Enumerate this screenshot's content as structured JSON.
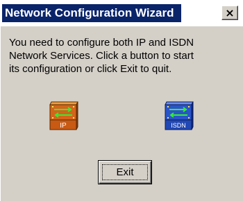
{
  "window": {
    "title": "Network Configuration Wizard",
    "close_glyph": "×"
  },
  "message": {
    "lines": [
      "You need to configure both IP and ISDN",
      "Network Services. Click a button to start",
      "its configuration or click Exit to quit."
    ]
  },
  "buttons": {
    "ip": {
      "label": "IP",
      "icon": "ip-network-icon",
      "color": "#d4641a"
    },
    "isdn": {
      "label": "ISDN",
      "icon": "isdn-network-icon",
      "color": "#2a55c8"
    },
    "exit": {
      "label": "Exit"
    }
  },
  "colors": {
    "titlebar": "#0a246a",
    "dialog_bg": "#d4d0c8"
  }
}
